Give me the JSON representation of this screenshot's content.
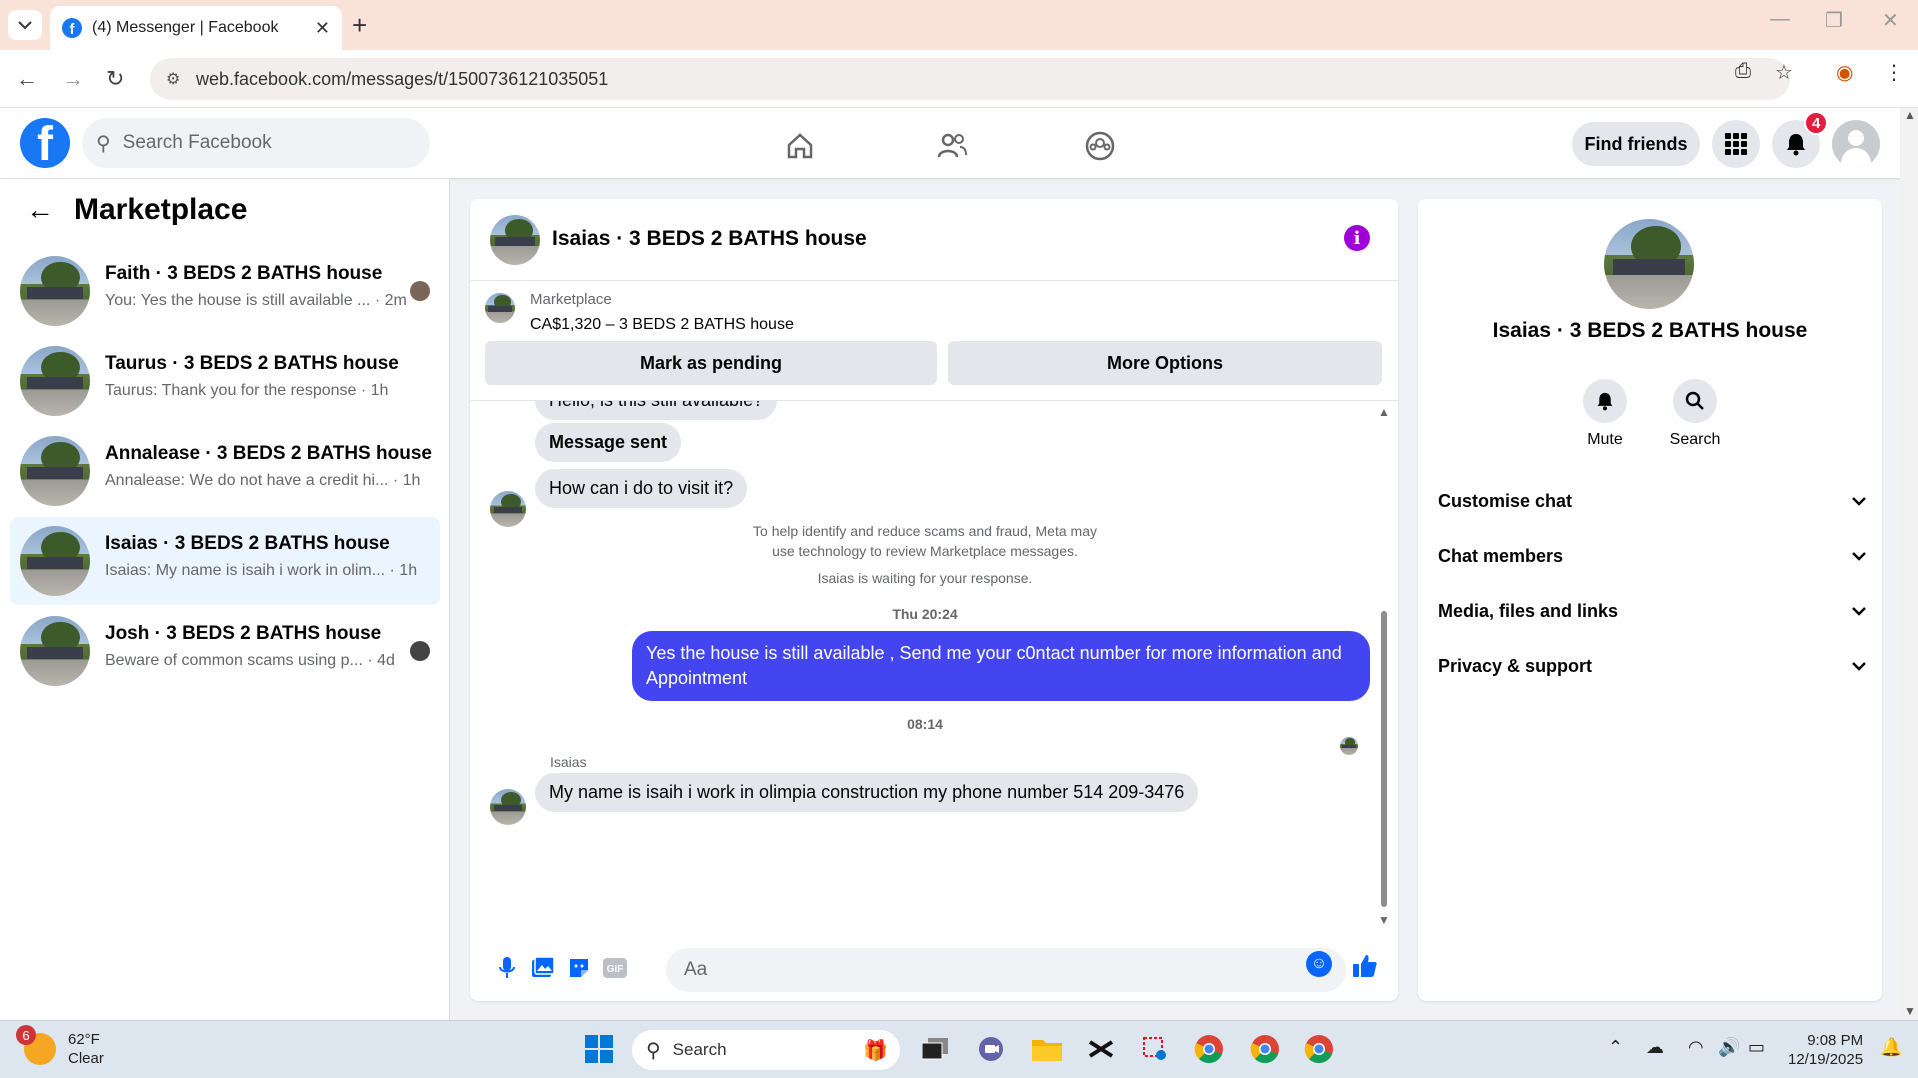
{
  "browser": {
    "tab_title": "(4) Messenger | Facebook",
    "url": "web.facebook.com/messages/t/1500736121035051"
  },
  "fb": {
    "search_placeholder": "Search Facebook",
    "find_friends": "Find friends",
    "notif_count": "4"
  },
  "left": {
    "title": "Marketplace",
    "conversations": [
      {
        "name": "Faith · 3 BEDS 2 BATHS house",
        "preview": "You: Yes the house is still available ... · 2m"
      },
      {
        "name": "Taurus · 3 BEDS 2 BATHS house",
        "preview": "Taurus: Thank you for the response · 1h"
      },
      {
        "name": "Annalease · 3 BEDS 2 BATHS house",
        "preview": "Annalease: We do not have a credit hi... · 1h"
      },
      {
        "name": "Isaias · 3 BEDS 2 BATHS house",
        "preview": "Isaias: My name is isaih i work in olim... · 1h"
      },
      {
        "name": "Josh · 3 BEDS 2 BATHS house",
        "preview": "Beware of common scams using p... · 4d"
      }
    ]
  },
  "chat": {
    "title": "Isaias · 3 BEDS 2 BATHS house",
    "marketplace_label": "Marketplace",
    "listing": "CA$1,320 – 3 BEDS 2 BATHS house",
    "mark_pending": "Mark as pending",
    "more_options": "More Options",
    "messages": {
      "m0": "Hello, is this still available?",
      "m1": "Message sent",
      "m2": "How can i do to visit it?",
      "sys1": "To help identify and reduce scams and fraud, Meta may use technology to review Marketplace messages.",
      "sys2": "Isaias is waiting for your response.",
      "ts1": "Thu 20:24",
      "out1": "Yes the house is still available , Send me your c0ntact number for more information and Appointment",
      "ts2": "08:14",
      "sender": "Isaias",
      "m3": "My name is isaih i work in olimpia construction my phone number 514 209-3476"
    },
    "composer_placeholder": "Aa"
  },
  "right": {
    "title": "Isaias · 3 BEDS 2 BATHS house",
    "mute": "Mute",
    "search": "Search",
    "rows": [
      "Customise chat",
      "Chat members",
      "Media, files and links",
      "Privacy & support"
    ]
  },
  "taskbar": {
    "temp": "62°F",
    "condition": "Clear",
    "weather_badge": "6",
    "search": "Search",
    "time": "9:08 PM",
    "date": "12/19/2025"
  },
  "colors": {
    "fb_blue": "#1877f2",
    "outgoing_bubble": "#4346f0",
    "active_conv": "#ebf5ff"
  }
}
